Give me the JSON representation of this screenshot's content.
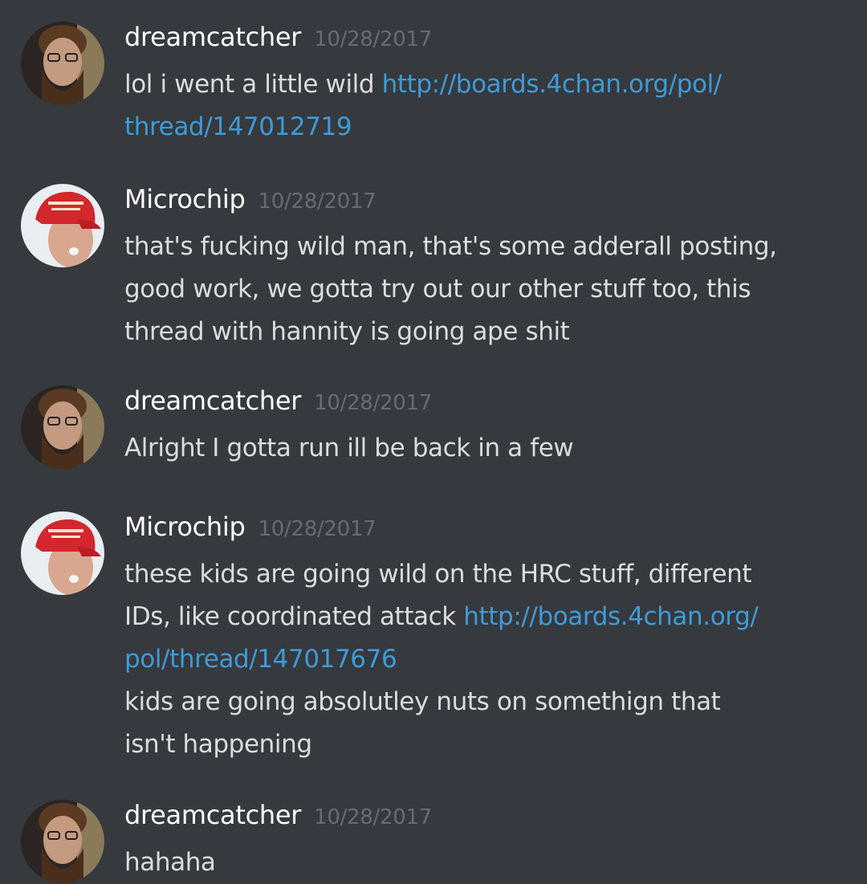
{
  "messages": [
    {
      "author": "dreamcatcher",
      "avatar": "bearded-man-avatar",
      "time": "10/28/2017",
      "lines": [
        [
          "lol i went a little wild ",
          "http://boards.4chan.org/pol/"
        ],
        [
          "",
          "thread/147012719"
        ]
      ]
    },
    {
      "author": "Microchip",
      "avatar": "red-cap-man-avatar",
      "time": "10/28/2017",
      "lines": [
        [
          "that's fucking wild man, that's some adderall posting,",
          ""
        ],
        [
          "good work, we gotta try out our other stuff too, this",
          ""
        ],
        [
          "thread with hannity is going ape shit",
          ""
        ]
      ]
    },
    {
      "author": "dreamcatcher",
      "avatar": "bearded-man-avatar",
      "time": "10/28/2017",
      "lines": [
        [
          "Alright I gotta run ill be back in a few",
          ""
        ]
      ]
    },
    {
      "author": "Microchip",
      "avatar": "red-cap-man-avatar",
      "time": "10/28/2017",
      "lines": [
        [
          "these kids are going wild on the HRC stuff, different",
          ""
        ],
        [
          "IDs, like coordinated attack ",
          "http://boards.4chan.org/"
        ],
        [
          "",
          "pol/thread/147017676"
        ],
        [
          "kids are going absolutley nuts on somethign that",
          ""
        ],
        [
          "isn't happening",
          ""
        ]
      ]
    },
    {
      "author": "dreamcatcher",
      "avatar": "bearded-man-avatar",
      "time": "10/28/2017",
      "lines": [
        [
          "hahaha",
          ""
        ]
      ]
    }
  ],
  "colors": {
    "background": "#36393e",
    "username": "#ffffff",
    "timestamp": "#686b70",
    "text": "#dcddde",
    "link": "#3e9bd8"
  }
}
